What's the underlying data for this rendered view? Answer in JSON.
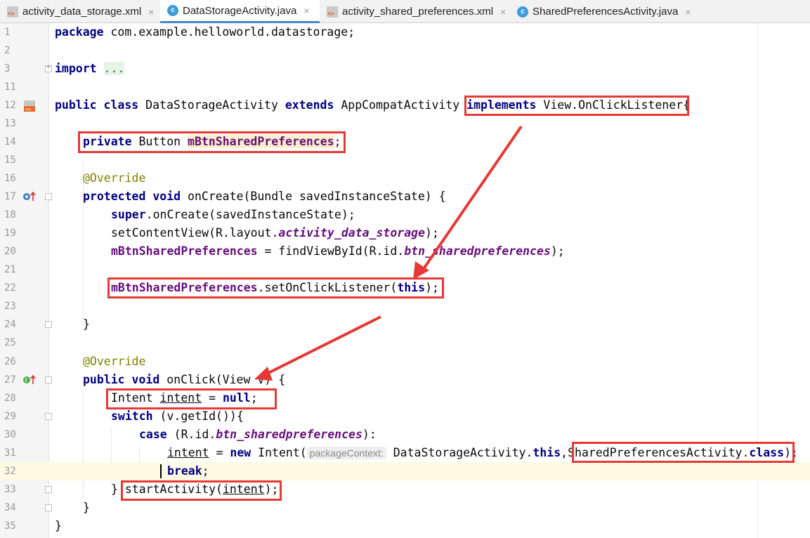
{
  "tabs": [
    {
      "label": "activity_data_storage.xml",
      "icon": "xml-file-icon",
      "active": false
    },
    {
      "label": "DataStorageActivity.java",
      "icon": "java-class-icon",
      "active": true
    },
    {
      "label": "activity_shared_preferences.xml",
      "icon": "xml-file-icon",
      "active": false
    },
    {
      "label": "SharedPreferencesActivity.java",
      "icon": "java-class-icon",
      "active": false
    }
  ],
  "tab_close_glyph": "×",
  "class_icon_letter": "c",
  "line_numbers": [
    "1",
    "2",
    "3",
    "11",
    "12",
    "13",
    "14",
    "15",
    "16",
    "17",
    "18",
    "19",
    "20",
    "21",
    "22",
    "23",
    "24",
    "25",
    "26",
    "27",
    "28",
    "29",
    "30",
    "31",
    "32",
    "33",
    "34",
    "35"
  ],
  "code": {
    "l1": {
      "kw": "package",
      "rest": " com.example.helloworld.datastorage;"
    },
    "l3": {
      "kw": "import",
      "fold": "..."
    },
    "l12": {
      "kw1": "public class",
      "name": " DataStorageActivity ",
      "kw2": "extends",
      "sup": " AppCompatActivity ",
      "kw3": "implements",
      "iface": " View.OnClickListener",
      "brace": "{"
    },
    "l14": {
      "kw": "private",
      "type": " Button ",
      "field": "mBtnSharedPreferences",
      "end": ";"
    },
    "l16": {
      "ann": "@Override"
    },
    "l17": {
      "kw": "protected void",
      "rest": " onCreate(Bundle savedInstanceState) {"
    },
    "l18": {
      "kw": "super",
      "rest": ".onCreate(savedInstanceState);"
    },
    "l19": {
      "pre": "setContentView(R.layout.",
      "ital": "activity_data_storage",
      "end": ");"
    },
    "l20": {
      "field": "mBtnSharedPreferences",
      "mid": " = findViewById(R.id.",
      "ital": "btn_sharedpreferences",
      "end": ");"
    },
    "l22": {
      "field": "mBtnSharedPreferences",
      "mid": ".setOnClickListener(",
      "kw": "this",
      "end": ");"
    },
    "l24": {
      "text": "}"
    },
    "l26": {
      "ann": "@Override"
    },
    "l27": {
      "kw": "public void",
      "rest": " onClick(View v) {"
    },
    "l28": {
      "type": "Intent ",
      "var": "intent",
      "mid": " = ",
      "kw": "null",
      "end": ";"
    },
    "l29": {
      "kw": "switch",
      "rest": " (v.getId()){"
    },
    "l30": {
      "kw": "case",
      "pre": " (R.id.",
      "ital": "btn_sharedpreferences",
      "end": "):"
    },
    "l31": {
      "var": "intent",
      "mid": " = ",
      "kw": "new",
      "call": " Intent(",
      "hint": "packageContext:",
      "arg": " DataStorageActivity.",
      "kw2": "this",
      "comma": ",",
      "cls": "SharedPreferencesActivity.",
      "kw3": "class",
      "end": ");"
    },
    "l32": {
      "kw": "break",
      "end": ";"
    },
    "l33": {
      "brace": "} ",
      "call": "startActivity(",
      "var": "intent",
      "end": ");"
    },
    "l34": {
      "text": "}"
    },
    "l35": {
      "text": "}"
    }
  },
  "colors": {
    "keyword": "#000080",
    "field": "#660e7a",
    "annotation": "#808000",
    "highlight_box": "#e53935",
    "active_tab_underline": "#4a86c8"
  },
  "gutter_icons": [
    {
      "line": "12",
      "icon": "xml-layout-icon"
    },
    {
      "line": "17",
      "icon": "override-up-arrow-icon"
    },
    {
      "line": "27",
      "icon": "implement-up-arrow-icon"
    }
  ]
}
